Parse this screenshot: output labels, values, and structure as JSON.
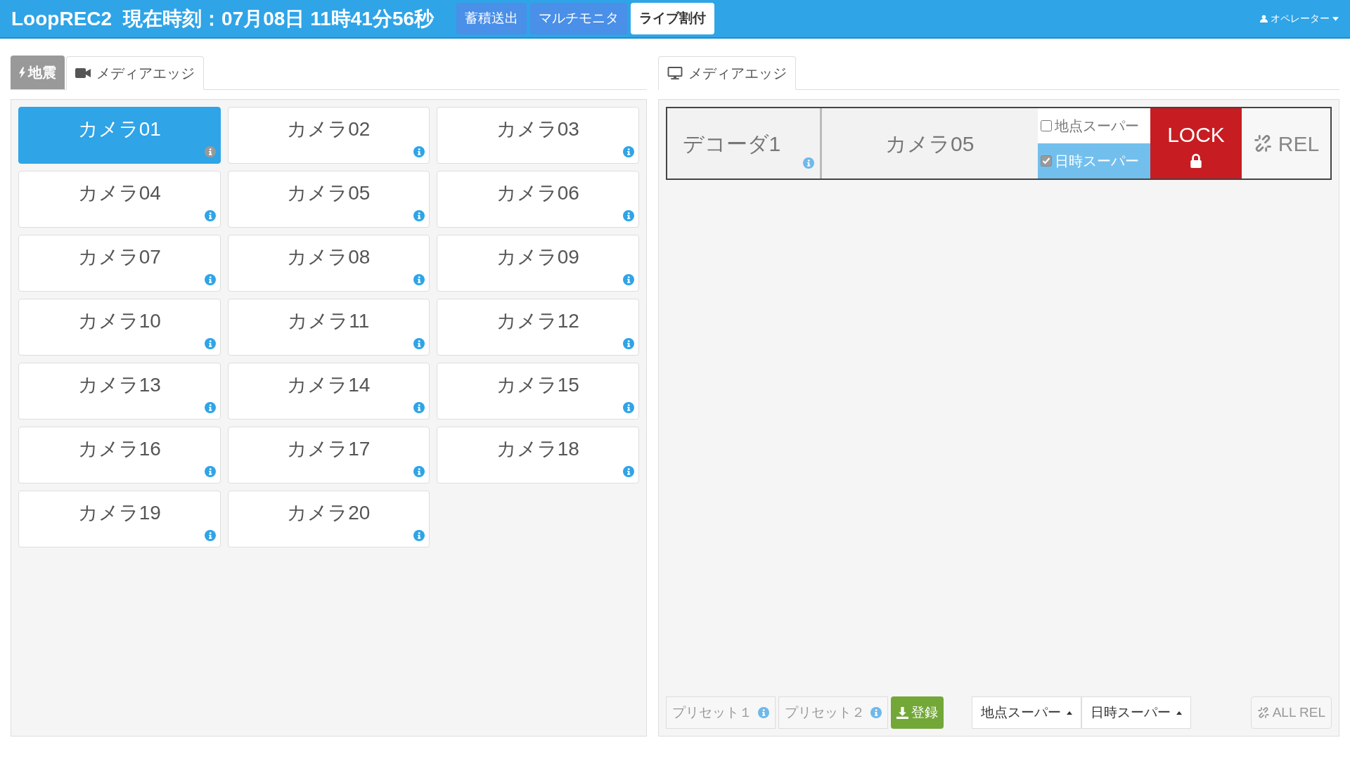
{
  "header": {
    "brand": "LoopREC2",
    "clock": "現在時刻：07月08日 11時41分56秒",
    "nav": [
      {
        "label": "蓄積送出",
        "selected": false
      },
      {
        "label": "マルチモニタ",
        "selected": false
      },
      {
        "label": "ライブ割付",
        "selected": true
      }
    ],
    "user": "オペレーター"
  },
  "left_panel": {
    "tabs": [
      {
        "label": "地震",
        "kind": "quake",
        "selected": false
      },
      {
        "label": "メディアエッジ",
        "kind": "camera",
        "selected": true
      }
    ],
    "cameras": [
      {
        "label": "カメラ01",
        "selected": true
      },
      {
        "label": "カメラ02",
        "selected": false
      },
      {
        "label": "カメラ03",
        "selected": false
      },
      {
        "label": "カメラ04",
        "selected": false
      },
      {
        "label": "カメラ05",
        "selected": false
      },
      {
        "label": "カメラ06",
        "selected": false
      },
      {
        "label": "カメラ07",
        "selected": false
      },
      {
        "label": "カメラ08",
        "selected": false
      },
      {
        "label": "カメラ09",
        "selected": false
      },
      {
        "label": "カメラ10",
        "selected": false
      },
      {
        "label": "カメラ11",
        "selected": false
      },
      {
        "label": "カメラ12",
        "selected": false
      },
      {
        "label": "カメラ13",
        "selected": false
      },
      {
        "label": "カメラ14",
        "selected": false
      },
      {
        "label": "カメラ15",
        "selected": false
      },
      {
        "label": "カメラ16",
        "selected": false
      },
      {
        "label": "カメラ17",
        "selected": false
      },
      {
        "label": "カメラ18",
        "selected": false
      },
      {
        "label": "カメラ19",
        "selected": false
      },
      {
        "label": "カメラ20",
        "selected": false
      }
    ]
  },
  "right_panel": {
    "tabs": [
      {
        "label": "メディアエッジ",
        "selected": true
      }
    ],
    "decoders": [
      {
        "name": "デコーダ1",
        "source": "カメラ05",
        "options": [
          {
            "label": "地点スーパー",
            "checked": false
          },
          {
            "label": "日時スーパー",
            "checked": true
          }
        ],
        "lock": "LOCK",
        "locked": true,
        "release": "REL"
      }
    ],
    "presets": [
      "プリセット１",
      "プリセット２"
    ],
    "register": "登録",
    "dropdowns": [
      "地点スーパー",
      "日時スーパー"
    ],
    "all_release": "ALL REL"
  }
}
